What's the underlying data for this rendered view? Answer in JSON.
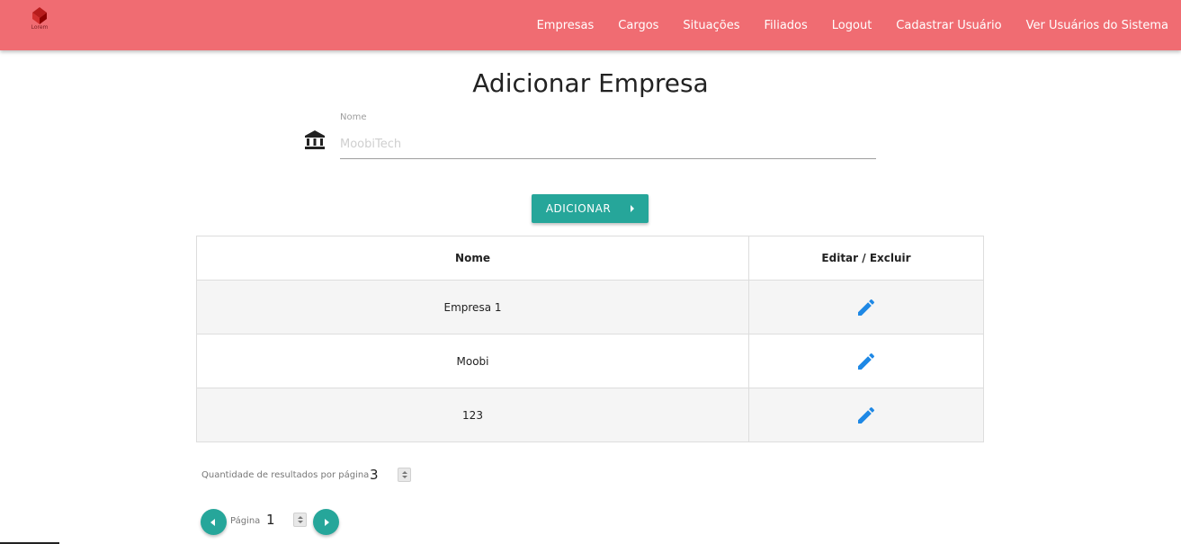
{
  "header": {
    "logo_text": "Lorem",
    "nav": [
      "Empresas",
      "Cargos",
      "Situações",
      "Filiados",
      "Logout",
      "Cadastrar Usuário",
      "Ver Usuários do Sistema"
    ]
  },
  "page": {
    "title": "Adicionar Empresa"
  },
  "form": {
    "field_label": "Nome",
    "field_placeholder": "MoobiTech",
    "field_icon": "bank-icon",
    "submit_label": "ADICIONAR"
  },
  "table": {
    "columns": [
      "Nome",
      "Editar / Excluir"
    ],
    "rows": [
      {
        "name": "Empresa 1"
      },
      {
        "name": "Moobi"
      },
      {
        "name": "123"
      }
    ],
    "row_icon": "pencil-edit-icon"
  },
  "pagination": {
    "per_page_label": "Quantidade de resultados por página",
    "per_page_value": "3",
    "page_label": "Página",
    "page_value": "1"
  },
  "colors": {
    "navbar": "#f06c72",
    "accent": "#26a69a",
    "edit_icon": "#1e88e5"
  }
}
